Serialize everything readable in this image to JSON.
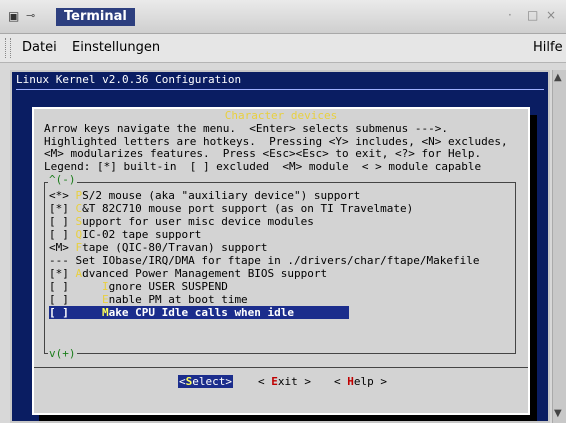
{
  "window": {
    "title": "Terminal",
    "controls": {
      "minimize": "·",
      "maximize": "□",
      "close": "×"
    }
  },
  "menubar": {
    "items": [
      "Datei",
      "Einstellungen",
      "Hilfe"
    ]
  },
  "terminal": {
    "heading": "Linux Kernel v2.0.36 Configuration",
    "dialog": {
      "title": "Character devices",
      "help": [
        "Arrow keys navigate the menu.  <Enter> selects submenus --->.",
        "Highlighted letters are hotkeys.  Pressing <Y> includes, <N> excludes,",
        "<M> modularizes features.  Press <Esc><Esc> to exit, <?> for Help.",
        "Legend: [*] built-in  [ ] excluded  <M> module  < > module capable"
      ],
      "scroll_up": "^(-)",
      "scroll_down": "v(+)",
      "items": [
        {
          "mark": "<*> ",
          "hotkey": "P",
          "rest": "S/2 mouse (aka \"auxiliary device\") support",
          "selected": false
        },
        {
          "mark": "[*] ",
          "hotkey": "C",
          "rest": "&T 82C710 mouse port support (as on TI Travelmate)",
          "selected": false
        },
        {
          "mark": "[ ] ",
          "hotkey": "S",
          "rest": "upport for user misc device modules",
          "selected": false
        },
        {
          "mark": "[ ] ",
          "hotkey": "Q",
          "rest": "IC-02 tape support",
          "selected": false
        },
        {
          "mark": "<M> ",
          "hotkey": "F",
          "rest": "tape (QIC-80/Travan) support",
          "selected": false
        },
        {
          "mark": "--- Set IObase/IRQ/DMA for ftape in ./drivers/char/ftape/Makefile",
          "hotkey": "",
          "rest": "",
          "selected": false
        },
        {
          "mark": "[*] ",
          "hotkey": "A",
          "rest": "dvanced Power Management BIOS support",
          "selected": false
        },
        {
          "mark": "[ ]     ",
          "hotkey": "I",
          "rest": "gnore USER SUSPEND",
          "selected": false
        },
        {
          "mark": "[ ]     ",
          "hotkey": "E",
          "rest": "nable PM at boot time",
          "selected": false
        },
        {
          "mark": "[ ]     ",
          "hotkey": "M",
          "rest": "ake CPU Idle calls when idle",
          "selected": true
        }
      ],
      "buttons": {
        "select": {
          "open": "<",
          "hotkey": "S",
          "rest": "elect>"
        },
        "exit": {
          "open": "< ",
          "hotkey": "E",
          "rest": "xit >"
        },
        "help": {
          "open": "< ",
          "hotkey": "H",
          "rest": "elp >"
        }
      }
    }
  },
  "colors": {
    "terminal_bg": "#0a1d62",
    "dialog_bg": "#d3d3d3",
    "selection": "#1b2d8c",
    "hotkey_yellow": "#e8d040",
    "button_hotkey": "#c00000"
  }
}
